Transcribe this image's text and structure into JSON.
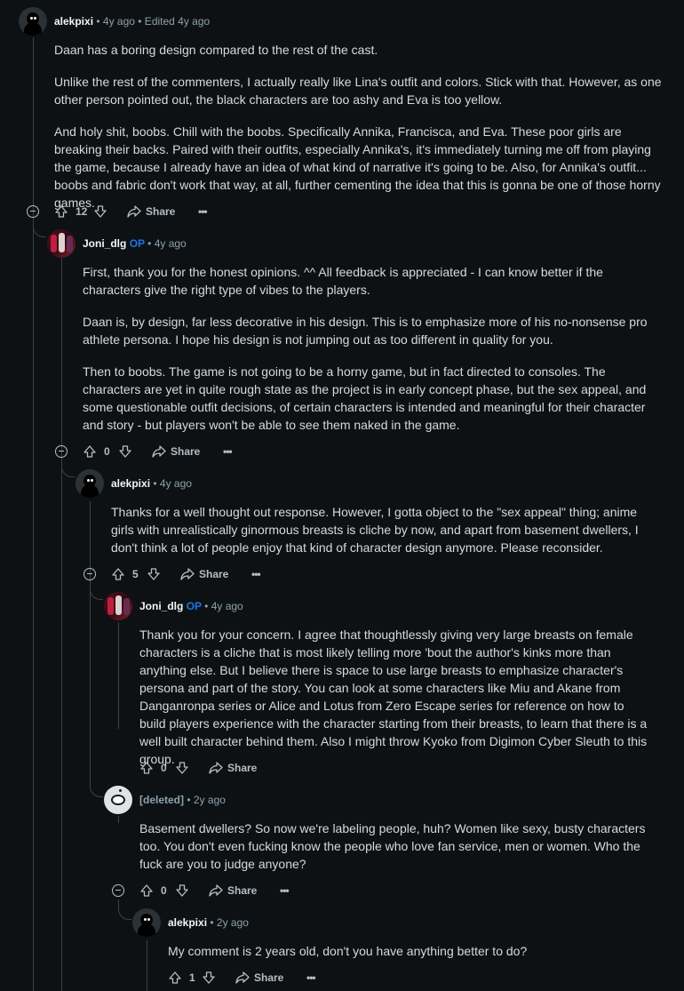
{
  "comments": [
    {
      "username": "alekpixi",
      "meta": "• 4y ago • Edited 4y ago",
      "paragraphs": [
        "Daan has a boring design compared to the rest of the cast.",
        "Unlike the rest of the commenters, I actually really like Lina's outfit and colors. Stick with that. However, as one other person pointed out, the black characters are too ashy and Eva is too yellow.",
        "And holy shit, boobs. Chill with the boobs. Specifically Annika, Francisca, and Eva. These poor girls are breaking their backs. Paired with their outfits, especially Annika's, it's immediately turning me off from playing the game, because I already have an idea of what kind of narrative it's going to be. Also, for Annika's outfit... boobs and fabric don't work that way, at all, further cementing the idea that this is gonna be one of those horny games."
      ],
      "votes": "12"
    },
    {
      "username": "Joni_dlg",
      "op": "OP",
      "meta": "• 4y ago",
      "paragraphs": [
        "First, thank you for the honest opinions. ^^ All feedback is appreciated - I can know better if the characters give the right type of vibes to the players.",
        "Daan is, by design, far less decorative in his design. This is to emphasize more of his no-nonsense pro athlete persona. I hope his design is not jumping out as too different in quality for you.",
        "Then to boobs. The game is not going to be a horny game, but in fact directed to consoles. The characters are yet in quite rough state as the project is in early concept phase, but the sex appeal, and some questionable outfit decisions, of certain characters is intended and meaningful for their character and story - but players won't be able to see them naked in the game."
      ],
      "votes": "0"
    },
    {
      "username": "alekpixi",
      "meta": "• 4y ago",
      "paragraphs": [
        "Thanks for a well thought out response. However, I gotta object to the \"sex appeal\" thing; anime girls with unrealistically ginormous breasts is cliche by now, and apart from basement dwellers, I don't think a lot of people enjoy that kind of character design anymore. Please reconsider."
      ],
      "votes": "5"
    },
    {
      "username": "Joni_dlg",
      "op": "OP",
      "meta": "• 4y ago",
      "paragraphs": [
        "Thank you for your concern. I agree that thoughtlessly giving very large breasts on female characters is a cliche that is most likely telling more 'bout the author's kinks more than anything else. But I believe there is space to use large breasts to emphasize character's persona and part of the story. You can look at some characters like Miu and Akane from Danganronpa series or Alice and Lotus from Zero Escape series for reference on how to build players experience with the character starting from their breasts, to learn that there is a well built character behind them. Also I might throw Kyoko from Digimon Cyber Sleuth to this group."
      ],
      "votes": "0"
    },
    {
      "username": "[deleted]",
      "meta": "• 2y ago",
      "paragraphs": [
        "Basement dwellers? So now we're labeling people, huh? Women like sexy, busty characters too. You don't even fucking know the people who love fan service, men or women. Who the fuck are you to judge anyone?"
      ],
      "votes": "0"
    },
    {
      "username": "alekpixi",
      "meta": "• 2y ago",
      "paragraphs": [
        "My comment is 2 years old, don't you have anything better to do?"
      ],
      "votes": "1"
    }
  ],
  "share_label": "Share",
  "more_label": "•••",
  "colors": {
    "background": "#0e1113",
    "text": "#d7dadc",
    "op": "#1d74e9",
    "meta": "#8ba2ad",
    "thread_line": "#3a4246"
  }
}
